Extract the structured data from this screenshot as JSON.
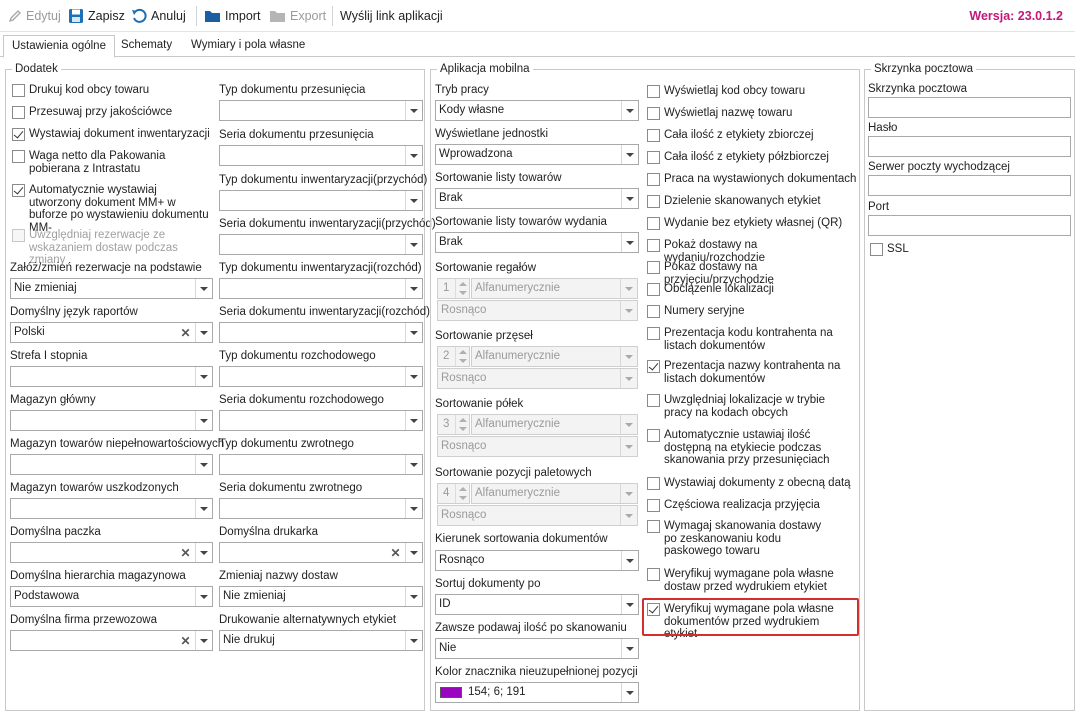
{
  "toolbar": {
    "edit": "Edytuj",
    "save": "Zapisz",
    "cancel": "Anuluj",
    "import": "Import",
    "export": "Export",
    "send_link": "Wyślij link aplikacji",
    "version": "Wersja: 23.0.1.2"
  },
  "tabs": [
    "Ustawienia ogólne",
    "Schematy",
    "Wymiary i pola własne"
  ],
  "dodatek": {
    "title": "Dodatek",
    "checkboxes": [
      {
        "label": "Drukuj kod obcy towaru",
        "checked": false
      },
      {
        "label": "Przesuwaj przy jakościówce",
        "checked": false
      },
      {
        "label": "Wystawiaj dokument inwentaryzacji",
        "checked": true
      },
      {
        "label": "Waga netto dla Pakowania pobierana z Intrastatu",
        "checked": false
      },
      {
        "label": "Automatycznie wystawiaj utworzony dokument MM+ w buforze po wystawieniu dokumentu MM-",
        "checked": true
      },
      {
        "label": "Uwzględniaj rezerwacje ze wskazaniem dostaw podczas zmiany",
        "checked": false,
        "disabled": true
      }
    ],
    "left_fields": [
      {
        "label": "Załóż/zmień rezerwacje na podstawie",
        "value": "Nie zmieniaj"
      },
      {
        "label": "Domyślny język raportów",
        "value": "Polski",
        "clear": true
      },
      {
        "label": "Strefa I stopnia",
        "value": ""
      },
      {
        "label": "Magazyn główny",
        "value": ""
      },
      {
        "label": "Magazyn towarów niepełnowartościowych",
        "value": ""
      },
      {
        "label": "Magazyn towarów uszkodzonych",
        "value": ""
      },
      {
        "label": "Domyślna paczka",
        "value": "",
        "clear": true
      },
      {
        "label": "Domyślna hierarchia magazynowa",
        "value": "Podstawowa"
      },
      {
        "label": "Domyślna firma przewozowa",
        "value": "",
        "clear": true
      }
    ],
    "right_fields": [
      {
        "label": "Typ dokumentu przesunięcia",
        "value": ""
      },
      {
        "label": "Seria dokumentu przesunięcia",
        "value": ""
      },
      {
        "label": "Typ dokumentu inwentaryzacji(przychód)",
        "value": ""
      },
      {
        "label": "Seria dokumentu inwentaryzacji(przychód)",
        "value": ""
      },
      {
        "label": "Typ dokumentu inwentaryzacji(rozchód)",
        "value": ""
      },
      {
        "label": "Seria dokumentu inwentaryzacji(rozchód)",
        "value": ""
      },
      {
        "label": "Typ dokumentu rozchodowego",
        "value": ""
      },
      {
        "label": "Seria dokumentu rozchodowego",
        "value": ""
      },
      {
        "label": "Typ dokumentu zwrotnego",
        "value": ""
      },
      {
        "label": "Seria dokumentu zwrotnego",
        "value": ""
      },
      {
        "label": "Domyślna drukarka",
        "value": "",
        "clear": true
      },
      {
        "label": "Zmieniaj nazwy dostaw",
        "value": "Nie zmieniaj"
      },
      {
        "label": "Drukowanie alternatywnych etykiet",
        "value": "Nie drukuj"
      }
    ]
  },
  "mobile": {
    "title": "Aplikacja mobilna",
    "fields": [
      {
        "label": "Tryb pracy",
        "value": "Kody własne"
      },
      {
        "label": "Wyświetlane jednostki",
        "value": "Wprowadzona"
      },
      {
        "label": "Sortowanie listy towarów",
        "value": "Brak"
      },
      {
        "label": "Sortowanie listy towarów wydania",
        "value": "Brak"
      }
    ],
    "sorts": [
      {
        "label": "Sortowanie regałów",
        "num": "1",
        "type": "Alfanumerycznie",
        "order": "Rosnąco"
      },
      {
        "label": "Sortowanie przęseł",
        "num": "2",
        "type": "Alfanumerycznie",
        "order": "Rosnąco"
      },
      {
        "label": "Sortowanie półek",
        "num": "3",
        "type": "Alfanumerycznie",
        "order": "Rosnąco"
      },
      {
        "label": "Sortowanie pozycji paletowych",
        "num": "4",
        "type": "Alfanumerycznie",
        "order": "Rosnąco"
      }
    ],
    "bottom_fields": [
      {
        "label": "Kierunek sortowania dokumentów",
        "value": "Rosnąco"
      },
      {
        "label": "Sortuj dokumenty po",
        "value": "ID"
      },
      {
        "label": "Zawsze podawaj ilość po skanowaniu",
        "value": "Nie"
      }
    ],
    "color": {
      "label": "Kolor znacznika nieuzupełnionej pozycji",
      "value": "154; 6; 191",
      "hex": "#9a06bf"
    },
    "checkboxes": [
      {
        "label": "Wyświetlaj kod obcy towaru",
        "checked": false
      },
      {
        "label": "Wyświetlaj nazwę towaru",
        "checked": false
      },
      {
        "label": "Cała ilość z etykiety zbiorczej",
        "checked": false
      },
      {
        "label": "Cała ilość z etykiety półzbiorczej",
        "checked": false
      },
      {
        "label": "Praca na wystawionych dokumentach",
        "checked": false
      },
      {
        "label": "Dzielenie skanowanych etykiet",
        "checked": false
      },
      {
        "label": "Wydanie bez etykiety własnej (QR)",
        "checked": false
      },
      {
        "label": "Pokaż dostawy na wydaniu/rozchodzie",
        "checked": false
      },
      {
        "label": "Pokaż dostawy na przyjęciu/przychodzie",
        "checked": false
      },
      {
        "label": "Obciążenie lokalizacji",
        "checked": false
      },
      {
        "label": "Numery seryjne",
        "checked": false
      },
      {
        "label": "Prezentacja kodu kontrahenta na listach dokumentów",
        "checked": false
      },
      {
        "label": "Prezentacja nazwy kontrahenta na listach dokumentów",
        "checked": true
      },
      {
        "label": "Uwzględniaj lokalizacje w trybie pracy na kodach obcych",
        "checked": false
      },
      {
        "label": "Automatycznie ustawiaj ilość dostępną na etykiecie podczas skanowania przy przesunięciach",
        "checked": false
      },
      {
        "label": "Wystawiaj dokumenty z obecną datą",
        "checked": false
      },
      {
        "label": "Częściowa realizacja przyjęcia",
        "checked": false
      },
      {
        "label": "Wymagaj skanowania dostawy po zeskanowaniu kodu paskowego towaru",
        "checked": false
      },
      {
        "label": "Weryfikuj wymagane pola własne dostaw przed wydrukiem etykiet",
        "checked": false
      },
      {
        "label": "Weryfikuj wymagane pola własne dokumentów przed wydrukiem etykiet",
        "checked": true
      }
    ]
  },
  "mailbox": {
    "title": "Skrzynka pocztowa",
    "fields": [
      {
        "label": "Skrzynka pocztowa",
        "value": ""
      },
      {
        "label": "Hasło",
        "value": ""
      },
      {
        "label": "Serwer poczty wychodzącej",
        "value": ""
      },
      {
        "label": "Port",
        "value": ""
      }
    ],
    "ssl": {
      "label": "SSL",
      "checked": false
    }
  }
}
